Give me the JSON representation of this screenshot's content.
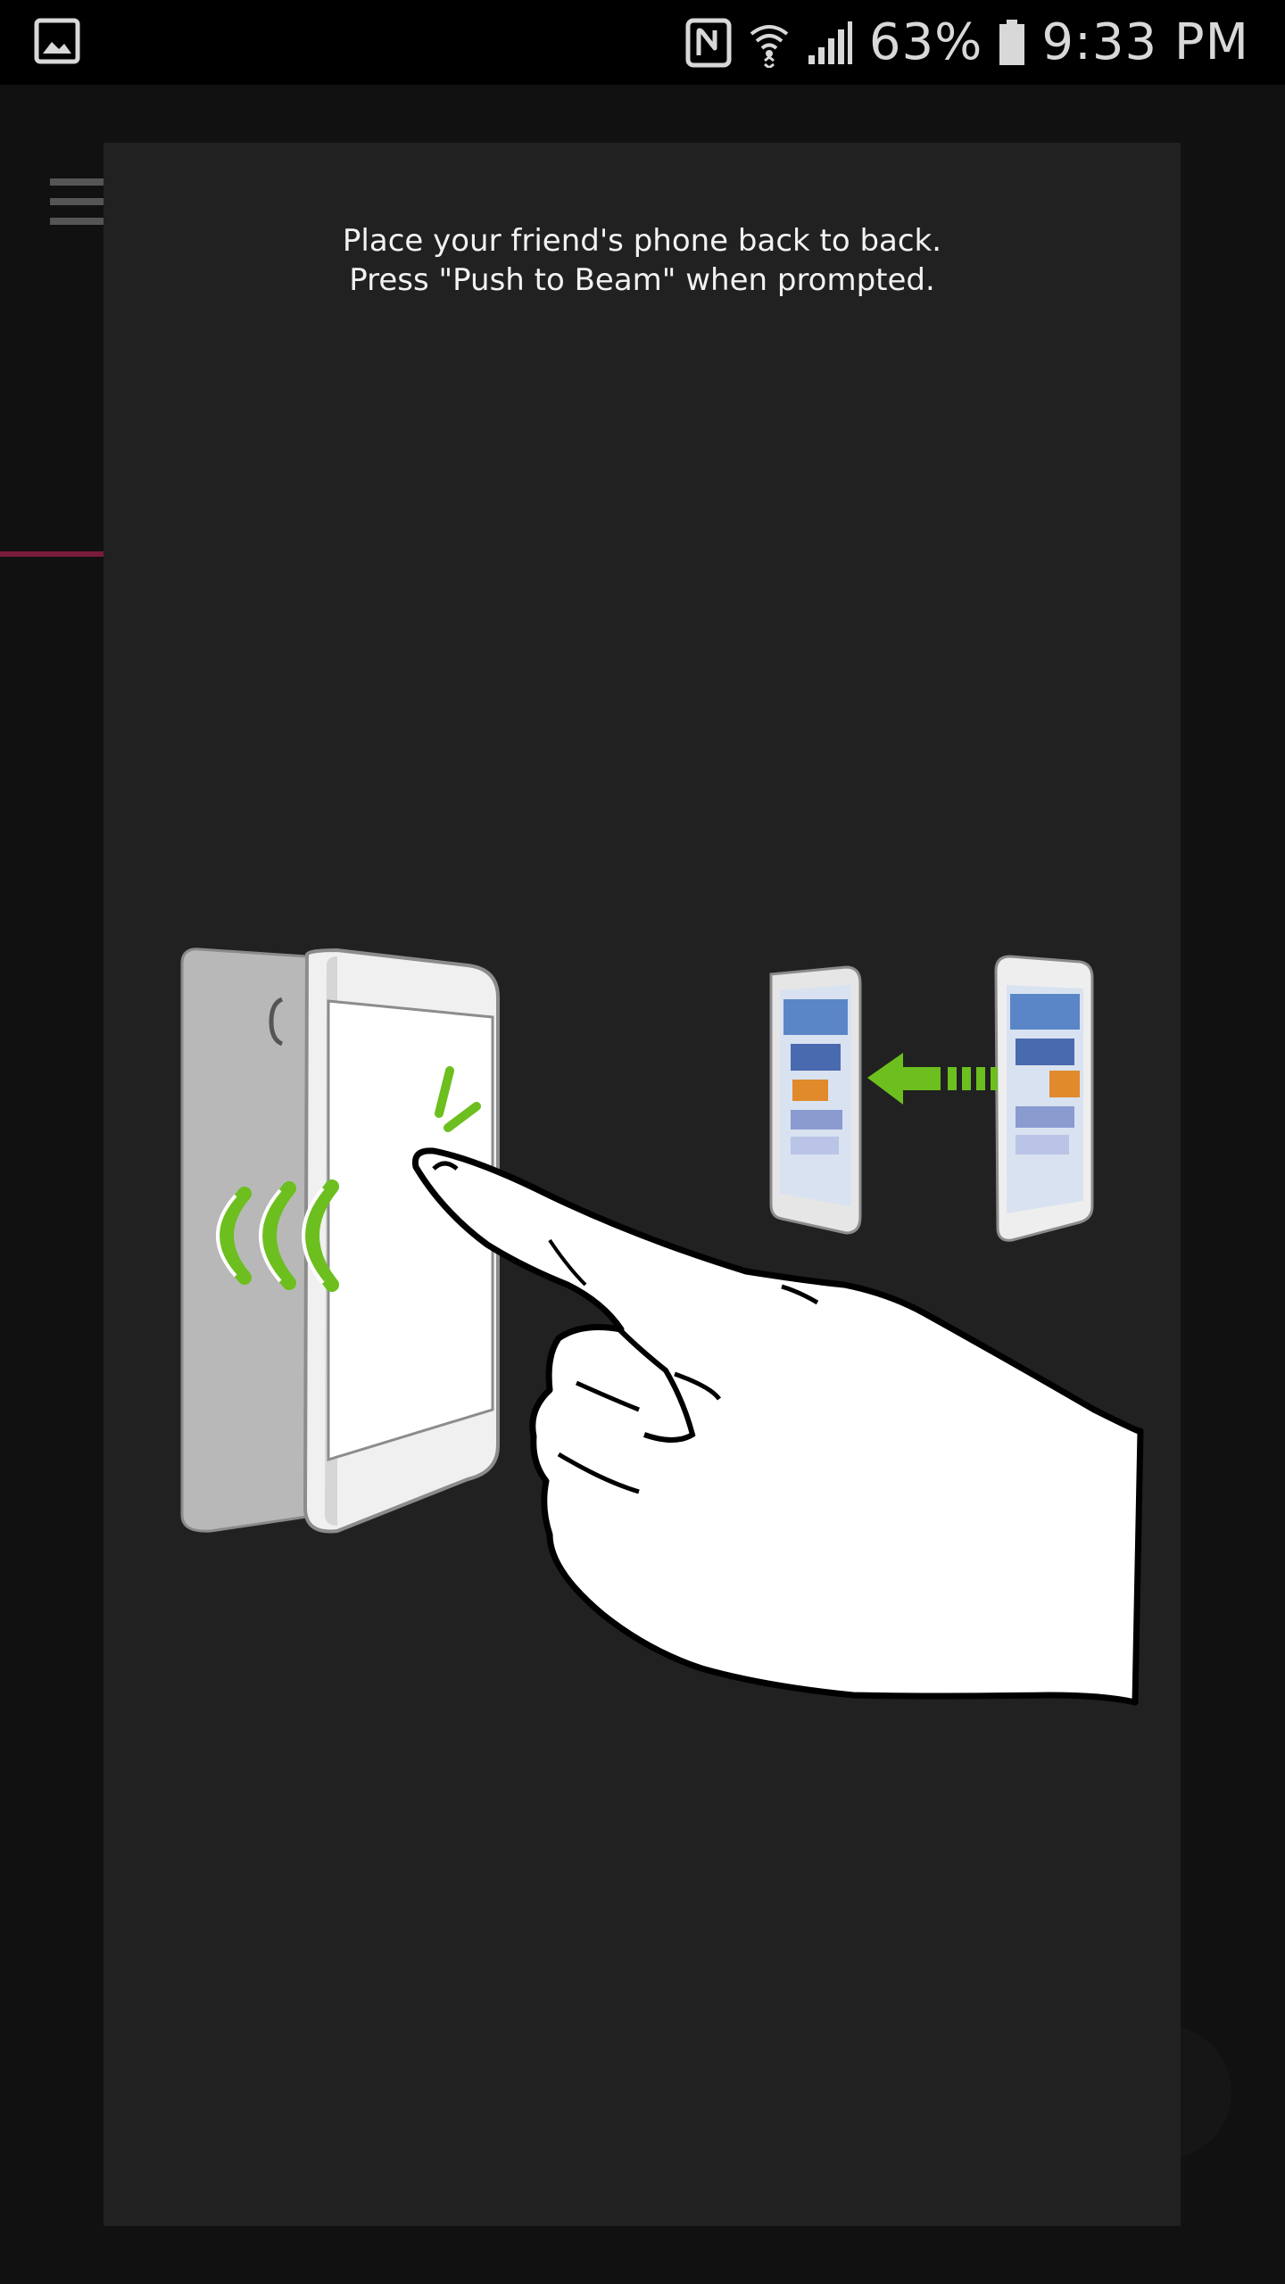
{
  "status_bar": {
    "battery_percent": "63%",
    "time": "9:33 PM",
    "icons": [
      "gallery-notification-icon",
      "nfc-icon",
      "wifi-icon",
      "cell-signal-icon",
      "battery-icon"
    ]
  },
  "dialog": {
    "instruction_line1": "Place your friend's phone back to back.",
    "instruction_line2": "Press \"Push to Beam\" when prompted.",
    "illustration": "nfc-push-to-beam-illustration"
  },
  "colors": {
    "status_bar_bg": "#000000",
    "dialog_bg": "#212121",
    "accent_green": "#6cbf1e",
    "accent_line": "#7a1b3c"
  }
}
